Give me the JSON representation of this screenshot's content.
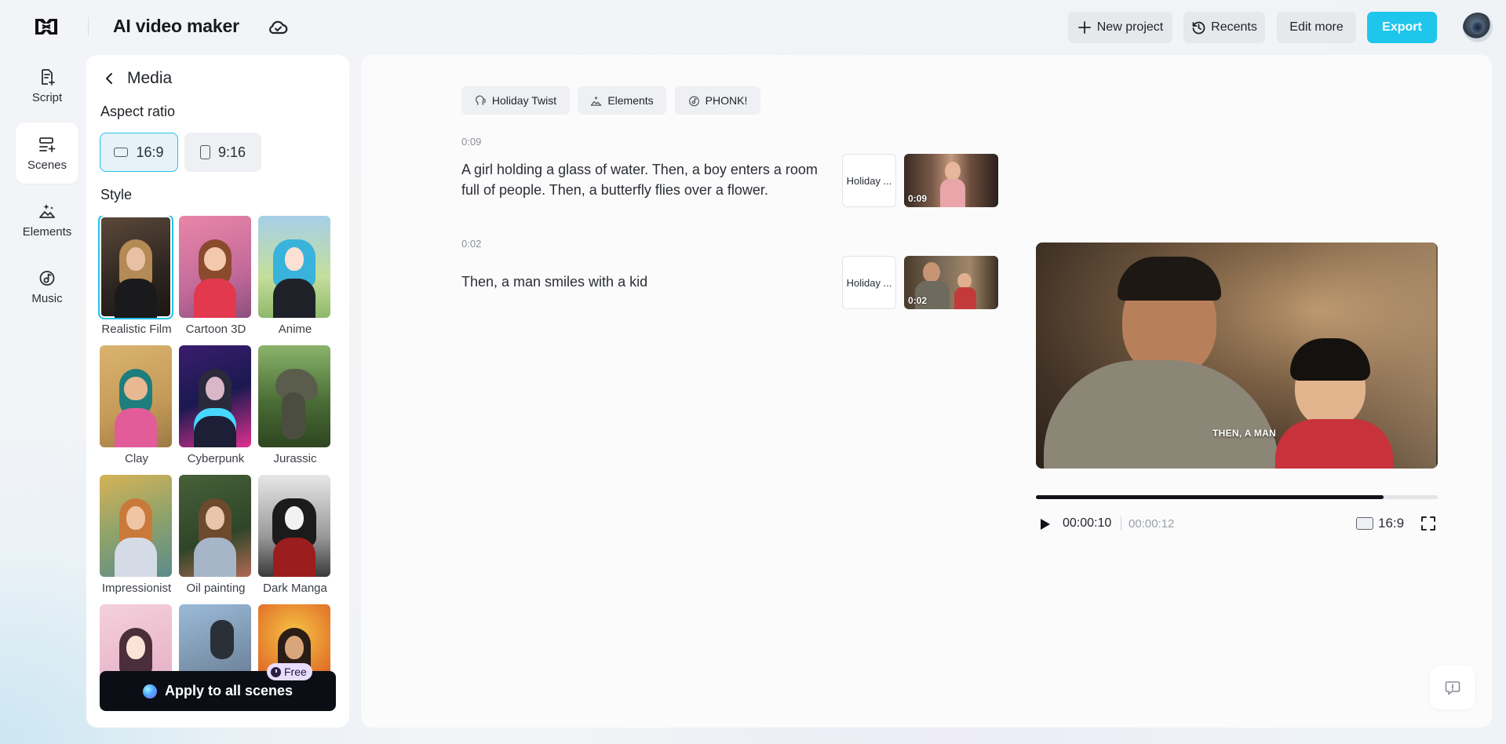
{
  "header": {
    "app_title": "AI video maker",
    "new_project_label": "New project",
    "recents_label": "Recents",
    "edit_more_label": "Edit more",
    "export_label": "Export"
  },
  "rail": {
    "items": [
      {
        "label": "Script",
        "icon": "script-icon"
      },
      {
        "label": "Scenes",
        "icon": "scenes-icon",
        "active": true
      },
      {
        "label": "Elements",
        "icon": "elements-icon"
      },
      {
        "label": "Music",
        "icon": "music-icon"
      }
    ]
  },
  "media_panel": {
    "title": "Media",
    "aspect_ratio_label": "Aspect ratio",
    "aspect_ratios": [
      "16:9",
      "9:16"
    ],
    "selected_aspect_ratio": "16:9",
    "style_label": "Style",
    "styles": [
      {
        "label": "Realistic Film",
        "selected": true
      },
      {
        "label": "Cartoon 3D"
      },
      {
        "label": "Anime"
      },
      {
        "label": "Clay"
      },
      {
        "label": "Cyberpunk"
      },
      {
        "label": "Jurassic"
      },
      {
        "label": "Impressionist"
      },
      {
        "label": "Oil painting"
      },
      {
        "label": "Dark Manga"
      }
    ],
    "apply_label": "Apply to all scenes",
    "free_badge": "Free"
  },
  "chips": {
    "voice": "Holiday Twist",
    "elements": "Elements",
    "music": "PHONK!"
  },
  "scenes": [
    {
      "time": "0:09",
      "text": "A girl holding a glass of water. Then, a boy enters a room full of people. Then, a butterfly flies over a flower.",
      "voice": "Holiday ...",
      "duration": "0:09"
    },
    {
      "time": "0:02",
      "text": "Then, a man smiles with a kid",
      "voice": "Holiday ...",
      "duration": "0:02"
    }
  ],
  "preview": {
    "caption": "THEN, A MAN",
    "current_time": "00:00:10",
    "total_time": "00:00:12",
    "progress": 0.865,
    "aspect_ratio": "16:9"
  },
  "colors": {
    "accent": "#1ec6ec",
    "apply_bg": "#0b0e14",
    "free_badge_bg": "#e9ddff"
  }
}
